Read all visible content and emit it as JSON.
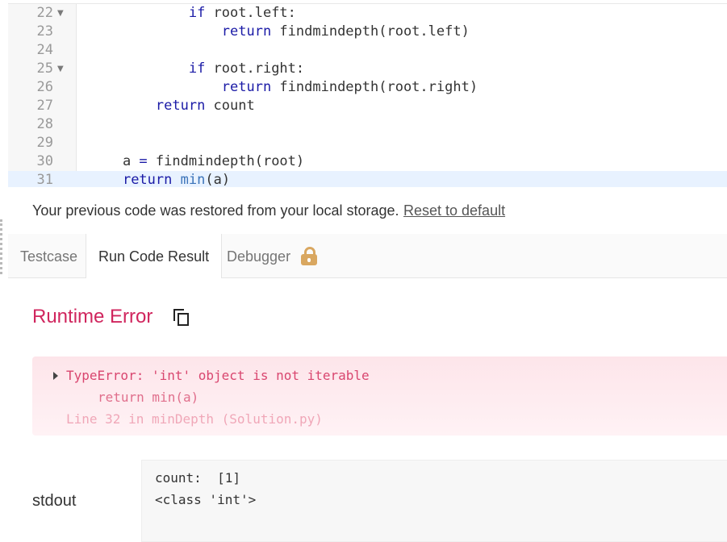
{
  "editor": {
    "lines": [
      {
        "num": "22",
        "fold": "▼",
        "tokens": [
          {
            "t": "            "
          },
          {
            "t": "if",
            "c": "kw"
          },
          {
            "t": " root.left:"
          }
        ]
      },
      {
        "num": "23",
        "fold": "",
        "tokens": [
          {
            "t": "                "
          },
          {
            "t": "return",
            "c": "kw"
          },
          {
            "t": " findmindepth(root.left)"
          }
        ]
      },
      {
        "num": "24",
        "fold": "",
        "tokens": [
          {
            "t": ""
          }
        ]
      },
      {
        "num": "25",
        "fold": "▼",
        "tokens": [
          {
            "t": "            "
          },
          {
            "t": "if",
            "c": "kw"
          },
          {
            "t": " root.right:"
          }
        ]
      },
      {
        "num": "26",
        "fold": "",
        "tokens": [
          {
            "t": "                "
          },
          {
            "t": "return",
            "c": "kw"
          },
          {
            "t": " findmindepth(root.right)"
          }
        ]
      },
      {
        "num": "27",
        "fold": "",
        "tokens": [
          {
            "t": "        "
          },
          {
            "t": "return",
            "c": "kw"
          },
          {
            "t": " count"
          }
        ]
      },
      {
        "num": "28",
        "fold": "",
        "tokens": [
          {
            "t": ""
          }
        ]
      },
      {
        "num": "29",
        "fold": "",
        "tokens": [
          {
            "t": ""
          }
        ]
      },
      {
        "num": "30",
        "fold": "",
        "tokens": [
          {
            "t": "    a "
          },
          {
            "t": "=",
            "c": "kw"
          },
          {
            "t": " findmindepth(root)"
          }
        ]
      },
      {
        "num": "31",
        "fold": "",
        "active": true,
        "tokens": [
          {
            "t": "    "
          },
          {
            "t": "return",
            "c": "kw"
          },
          {
            "t": " "
          },
          {
            "t": "min",
            "c": "bi"
          },
          {
            "t": "(a)"
          }
        ]
      }
    ]
  },
  "notice": {
    "text": "Your previous code was restored from your local storage.",
    "reset_label": "Reset to default"
  },
  "tabs": [
    {
      "label": "Testcase",
      "active": false
    },
    {
      "label": "Run Code Result",
      "active": true
    },
    {
      "label": "Debugger",
      "active": false,
      "locked": true
    }
  ],
  "result": {
    "status": "Runtime Error",
    "error": {
      "message": "TypeError: 'int' object is not iterable",
      "code": "return min(a)",
      "location": "Line 32 in minDepth (Solution.py)"
    },
    "stdout_label": "stdout",
    "stdout_lines": [
      "count:  [1]",
      "<class 'int'>"
    ]
  },
  "colors": {
    "error_title": "#d0265e",
    "keyword": "#1a1aa6",
    "builtin": "#3b73b9",
    "lock": "#d9a760"
  }
}
